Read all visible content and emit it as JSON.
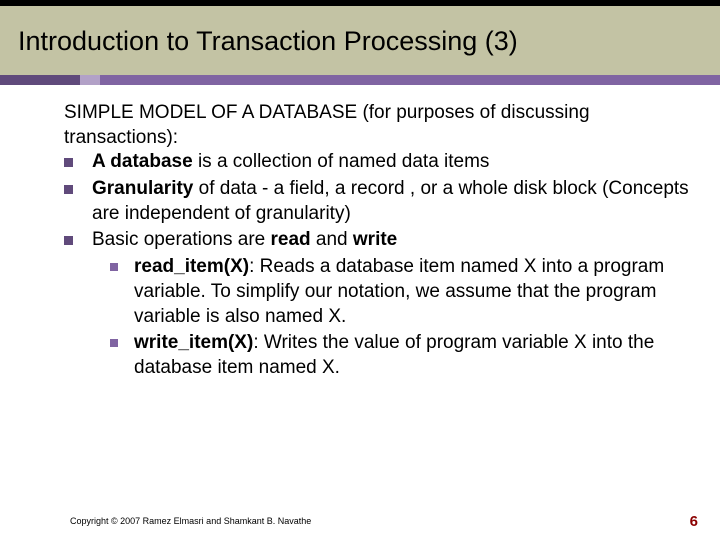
{
  "title": "Introduction to Transaction Processing (3)",
  "intro": "SIMPLE MODEL OF A DATABASE (for purposes of discussing transactions):",
  "bullets": {
    "b0": {
      "bold": "A database",
      "rest": " is a collection of named data items"
    },
    "b1": {
      "bold": "Granularity",
      "rest": " of data - a field, a record , or a whole disk block (Concepts are independent of granularity)"
    },
    "b2": {
      "pre": "Basic operations are ",
      "bold1": "read",
      "mid": " and ",
      "bold2": "write",
      "sub": {
        "s0": {
          "bold": "read_item(X)",
          "rest": ": Reads a database item named X into a program variable. To simplify our notation, we assume that the program variable is also named X."
        },
        "s1": {
          "bold": "write_item(X)",
          "rest": ": Writes the value of program variable X into the database item named X."
        }
      }
    }
  },
  "footer": "Copyright © 2007 Ramez Elmasri and Shamkant B. Navathe",
  "page": "6"
}
